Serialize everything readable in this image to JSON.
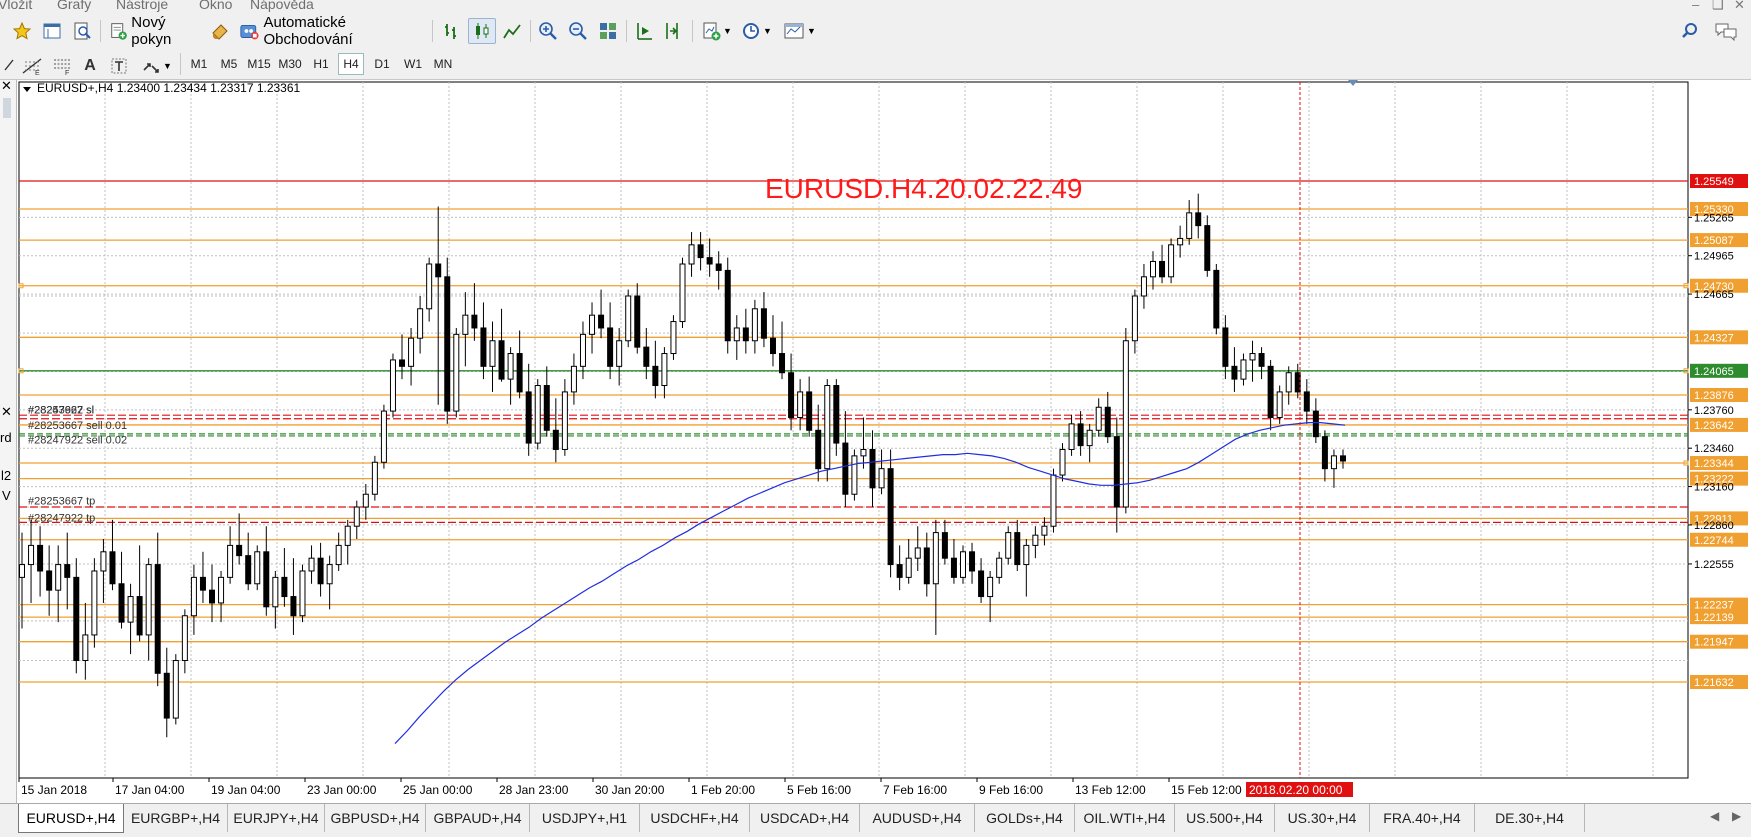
{
  "menu": [
    "Vložit",
    "Grafy",
    "Nástroje",
    "Okno",
    "Nápověda"
  ],
  "toolbar": {
    "new_order_label": "Nový pokyn",
    "auto_trading_label": "Automatické Obchodování",
    "timeframes": [
      "M1",
      "M5",
      "M15",
      "M30",
      "H1",
      "H4",
      "D1",
      "W1",
      "MN"
    ],
    "active_timeframe": "H4",
    "icons": [
      "favorites-icon",
      "data-window-icon",
      "navigator-icon",
      "new-order-icon",
      "metaeditor-icon",
      "auto-trading-icon",
      "bar-chart-icon",
      "candlestick-icon",
      "line-chart-icon",
      "zoom-in-icon",
      "zoom-out-icon",
      "tile-windows-icon",
      "chart-shift-icon",
      "auto-scroll-icon",
      "indicators-icon",
      "periodicity-icon",
      "templates-icon",
      "search-icon",
      "chat-icon",
      "cursor-icon",
      "fibonacci-icon",
      "channel-icon",
      "text-icon",
      "text-label-icon",
      "arrows-icon"
    ]
  },
  "chart": {
    "header_label": "EURUSD+,H4",
    "ohlc": "1.23400 1.23434 1.23317 1.23361",
    "watermark": "EURUSD.H4.20.02.22.49",
    "colors": {
      "background": "#ffffff",
      "grid": "#c0c0c0",
      "candle": "#000000",
      "ma": "#1f2ee0",
      "level": "#f0a030",
      "support": "#2e8b2e",
      "alert": "#e01010",
      "text": "#ff1a1a"
    },
    "price_labels": [
      {
        "price": 1.25549,
        "text": "1.25549",
        "kind": "alert"
      },
      {
        "price": 1.2533,
        "text": "1.25330",
        "kind": "level"
      },
      {
        "price": 1.25265,
        "text": "1.25265",
        "kind": "tick"
      },
      {
        "price": 1.25087,
        "text": "1.25087",
        "kind": "level"
      },
      {
        "price": 1.24965,
        "text": "1.24965",
        "kind": "tick"
      },
      {
        "price": 1.2473,
        "text": "1.24730",
        "kind": "level"
      },
      {
        "price": 1.24665,
        "text": "1.24665",
        "kind": "tick"
      },
      {
        "price": 1.24327,
        "text": "1.24327",
        "kind": "level"
      },
      {
        "price": 1.24065,
        "text": "1.24065",
        "kind": "support"
      },
      {
        "price": 1.23876,
        "text": "1.23876",
        "kind": "level"
      },
      {
        "price": 1.2376,
        "text": "1.23760",
        "kind": "tick"
      },
      {
        "price": 1.23642,
        "text": "1.23642",
        "kind": "level"
      },
      {
        "price": 1.2346,
        "text": "1.23460",
        "kind": "tick"
      },
      {
        "price": 1.23344,
        "text": "1.23344",
        "kind": "level"
      },
      {
        "price": 1.23222,
        "text": "1.23222",
        "kind": "level"
      },
      {
        "price": 1.2316,
        "text": "1.23160",
        "kind": "tick"
      },
      {
        "price": 1.22911,
        "text": "1.22911",
        "kind": "level"
      },
      {
        "price": 1.2286,
        "text": "1.22860",
        "kind": "tick"
      },
      {
        "price": 1.22744,
        "text": "1.22744",
        "kind": "level"
      },
      {
        "price": 1.22555,
        "text": "1.22555",
        "kind": "tick"
      },
      {
        "price": 1.22237,
        "text": "1.22237",
        "kind": "level"
      },
      {
        "price": 1.22139,
        "text": "1.22139",
        "kind": "level"
      },
      {
        "price": 1.21947,
        "text": "1.21947",
        "kind": "level"
      },
      {
        "price": 1.21632,
        "text": "1.21632",
        "kind": "level"
      }
    ],
    "extra_levels": [
      1.23718,
      1.2369,
      1.23572,
      1.23556,
      1.23,
      1.2288
    ],
    "order_labels": [
      {
        "price": 1.2373,
        "text": "#28253667 sl",
        "color": "#333333"
      },
      {
        "price": 1.2373,
        "text": "#28247922 sl",
        "color": "#333333"
      },
      {
        "price": 1.23586,
        "text": "#28253667 sell 0.01",
        "color": "#333333"
      },
      {
        "price": 1.23552,
        "text": "#28247922 sell 0.02",
        "color": "#333333"
      },
      {
        "price": 1.22988,
        "text": "#28253667 tp",
        "color": "#333333"
      },
      {
        "price": 1.22885,
        "text": "#28247922 tp",
        "color": "#333333"
      }
    ],
    "x_axis_labels": [
      "15 Jan 2018",
      "17 Jan 04:00",
      "19 Jan 04:00",
      "23 Jan 00:00",
      "25 Jan 00:00",
      "28 Jan 23:00",
      "30 Jan 20:00",
      "1 Feb 20:00",
      "5 Feb 16:00",
      "7 Feb 16:00",
      "9 Feb 16:00",
      "13 Feb 12:00",
      "15 Feb 12:00"
    ],
    "cursor_label": "2018.02.20 00:00",
    "left_strip_text": [
      "rd",
      "l2",
      "V"
    ]
  },
  "tabs": [
    {
      "label": "EURUSD+,H4",
      "active": true
    },
    {
      "label": "EURGBP+,H4",
      "active": false
    },
    {
      "label": "EURJPY+,H4",
      "active": false
    },
    {
      "label": "GBPUSD+,H4",
      "active": false
    },
    {
      "label": "GBPAUD+,H4",
      "active": false
    },
    {
      "label": "USDJPY+,H1",
      "active": false
    },
    {
      "label": "USDCHF+,H4",
      "active": false
    },
    {
      "label": "USDCAD+,H4",
      "active": false
    },
    {
      "label": "AUDUSD+,H4",
      "active": false
    },
    {
      "label": "GOLDs+,H4",
      "active": false
    },
    {
      "label": "OIL.WTI+,H4",
      "active": false
    },
    {
      "label": "US.500+,H4",
      "active": false
    },
    {
      "label": "US.30+,H4",
      "active": false
    },
    {
      "label": "FRA.40+,H4",
      "active": false
    },
    {
      "label": "DE.30+,H4",
      "active": false
    }
  ],
  "chart_data": {
    "type": "candlestick",
    "symbol": "EURUSD+",
    "timeframe": "H4",
    "ylim": [
      1.2155,
      1.2565
    ],
    "grid": true,
    "candles": [
      [
        1.2245,
        1.228,
        1.2205,
        1.2255
      ],
      [
        1.2255,
        1.229,
        1.2225,
        1.227
      ],
      [
        1.227,
        1.2285,
        1.223,
        1.225
      ],
      [
        1.225,
        1.227,
        1.2215,
        1.2235
      ],
      [
        1.2235,
        1.227,
        1.221,
        1.2255
      ],
      [
        1.2255,
        1.228,
        1.222,
        1.2245
      ],
      [
        1.2245,
        1.226,
        1.217,
        1.218
      ],
      [
        1.218,
        1.2225,
        1.2165,
        1.22
      ],
      [
        1.22,
        1.226,
        1.219,
        1.225
      ],
      [
        1.225,
        1.2275,
        1.2225,
        1.2265
      ],
      [
        1.2265,
        1.229,
        1.2235,
        1.224
      ],
      [
        1.224,
        1.2265,
        1.2205,
        1.221
      ],
      [
        1.221,
        1.224,
        1.2185,
        1.223
      ],
      [
        1.223,
        1.227,
        1.2195,
        1.22
      ],
      [
        1.22,
        1.226,
        1.218,
        1.2255
      ],
      [
        1.2255,
        1.228,
        1.216,
        1.217
      ],
      [
        1.217,
        1.219,
        1.212,
        1.2135
      ],
      [
        1.2135,
        1.2185,
        1.213,
        1.218
      ],
      [
        1.218,
        1.222,
        1.217,
        1.2215
      ],
      [
        1.2215,
        1.2255,
        1.22,
        1.2245
      ],
      [
        1.2245,
        1.2265,
        1.2225,
        1.2235
      ],
      [
        1.2235,
        1.2255,
        1.221,
        1.2225
      ],
      [
        1.2225,
        1.225,
        1.221,
        1.2245
      ],
      [
        1.2245,
        1.2285,
        1.224,
        1.227
      ],
      [
        1.227,
        1.2295,
        1.2255,
        1.2262
      ],
      [
        1.2262,
        1.228,
        1.2235,
        1.224
      ],
      [
        1.224,
        1.227,
        1.2235,
        1.2265
      ],
      [
        1.2265,
        1.2285,
        1.2215,
        1.2222
      ],
      [
        1.2222,
        1.225,
        1.2205,
        1.2245
      ],
      [
        1.2245,
        1.2268,
        1.2222,
        1.223
      ],
      [
        1.223,
        1.226,
        1.22,
        1.2215
      ],
      [
        1.2215,
        1.2255,
        1.221,
        1.225
      ],
      [
        1.225,
        1.227,
        1.224,
        1.226
      ],
      [
        1.226,
        1.2272,
        1.223,
        1.224
      ],
      [
        1.224,
        1.2262,
        1.222,
        1.2255
      ],
      [
        1.2255,
        1.228,
        1.225,
        1.227
      ],
      [
        1.227,
        1.229,
        1.2255,
        1.2285
      ],
      [
        1.2285,
        1.2305,
        1.2275,
        1.23
      ],
      [
        1.23,
        1.2318,
        1.229,
        1.231
      ],
      [
        1.231,
        1.234,
        1.2305,
        1.2335
      ],
      [
        1.2335,
        1.238,
        1.233,
        1.2375
      ],
      [
        1.2375,
        1.242,
        1.237,
        1.2415
      ],
      [
        1.2415,
        1.2435,
        1.24,
        1.241
      ],
      [
        1.241,
        1.244,
        1.2395,
        1.2432
      ],
      [
        1.2432,
        1.2465,
        1.242,
        1.2455
      ],
      [
        1.2455,
        1.2495,
        1.2445,
        1.249
      ],
      [
        1.249,
        1.2535,
        1.238,
        1.248
      ],
      [
        1.248,
        1.2495,
        1.2365,
        1.2375
      ],
      [
        1.2375,
        1.244,
        1.237,
        1.2435
      ],
      [
        1.2435,
        1.2468,
        1.241,
        1.245
      ],
      [
        1.245,
        1.2475,
        1.243,
        1.244
      ],
      [
        1.244,
        1.246,
        1.24,
        1.241
      ],
      [
        1.241,
        1.2445,
        1.239,
        1.243
      ],
      [
        1.243,
        1.2455,
        1.2398,
        1.24
      ],
      [
        1.24,
        1.2425,
        1.238,
        1.242
      ],
      [
        1.242,
        1.2438,
        1.2385,
        1.239
      ],
      [
        1.239,
        1.2412,
        1.234,
        1.235
      ],
      [
        1.235,
        1.24,
        1.2345,
        1.2395
      ],
      [
        1.2395,
        1.241,
        1.2355,
        1.236
      ],
      [
        1.236,
        1.2385,
        1.2335,
        1.2345
      ],
      [
        1.2345,
        1.24,
        1.234,
        1.239
      ],
      [
        1.239,
        1.242,
        1.238,
        1.241
      ],
      [
        1.241,
        1.2445,
        1.24,
        1.2435
      ],
      [
        1.2435,
        1.246,
        1.242,
        1.245
      ],
      [
        1.245,
        1.247,
        1.2432,
        1.244
      ],
      [
        1.244,
        1.246,
        1.24,
        1.241
      ],
      [
        1.241,
        1.244,
        1.2395,
        1.243
      ],
      [
        1.243,
        1.247,
        1.2425,
        1.2465
      ],
      [
        1.2465,
        1.2475,
        1.242,
        1.2425
      ],
      [
        1.2425,
        1.244,
        1.24,
        1.241
      ],
      [
        1.241,
        1.243,
        1.2385,
        1.2395
      ],
      [
        1.2395,
        1.2425,
        1.2385,
        1.242
      ],
      [
        1.242,
        1.245,
        1.2415,
        1.2445
      ],
      [
        1.2445,
        1.2495,
        1.244,
        1.249
      ],
      [
        1.249,
        1.2515,
        1.248,
        1.2505
      ],
      [
        1.2505,
        1.2515,
        1.2485,
        1.2495
      ],
      [
        1.2495,
        1.251,
        1.248,
        1.249
      ],
      [
        1.249,
        1.25,
        1.247,
        1.2485
      ],
      [
        1.2485,
        1.2495,
        1.242,
        1.243
      ],
      [
        1.243,
        1.245,
        1.2415,
        1.244
      ],
      [
        1.244,
        1.2455,
        1.242,
        1.243
      ],
      [
        1.243,
        1.2462,
        1.242,
        1.2455
      ],
      [
        1.2455,
        1.2468,
        1.2425,
        1.2432
      ],
      [
        1.2432,
        1.245,
        1.241,
        1.242
      ],
      [
        1.242,
        1.2445,
        1.24,
        1.2405
      ],
      [
        1.2405,
        1.242,
        1.236,
        1.237
      ],
      [
        1.237,
        1.24,
        1.236,
        1.239
      ],
      [
        1.239,
        1.2402,
        1.2355,
        1.236
      ],
      [
        1.236,
        1.238,
        1.232,
        1.233
      ],
      [
        1.233,
        1.24,
        1.232,
        1.2395
      ],
      [
        1.2395,
        1.24,
        1.234,
        1.235
      ],
      [
        1.235,
        1.2375,
        1.23,
        1.231
      ],
      [
        1.231,
        1.2345,
        1.2305,
        1.234
      ],
      [
        1.234,
        1.237,
        1.233,
        1.2345
      ],
      [
        1.2345,
        1.236,
        1.23,
        1.2315
      ],
      [
        1.2315,
        1.2345,
        1.231,
        1.233
      ],
      [
        1.233,
        1.2345,
        1.2245,
        1.2255
      ],
      [
        1.2255,
        1.227,
        1.2235,
        1.2245
      ],
      [
        1.2245,
        1.2275,
        1.224,
        1.226
      ],
      [
        1.226,
        1.2285,
        1.225,
        1.2268
      ],
      [
        1.2268,
        1.228,
        1.223,
        1.224
      ],
      [
        1.224,
        1.229,
        1.22,
        1.228
      ],
      [
        1.228,
        1.229,
        1.2255,
        1.226
      ],
      [
        1.226,
        1.2275,
        1.224,
        1.2245
      ],
      [
        1.2245,
        1.227,
        1.224,
        1.2265
      ],
      [
        1.2265,
        1.2272,
        1.224,
        1.225
      ],
      [
        1.225,
        1.226,
        1.2225,
        1.223
      ],
      [
        1.223,
        1.225,
        1.221,
        1.2245
      ],
      [
        1.2245,
        1.2265,
        1.224,
        1.226
      ],
      [
        1.226,
        1.2285,
        1.2255,
        1.228
      ],
      [
        1.228,
        1.229,
        1.225,
        1.2255
      ],
      [
        1.2255,
        1.2275,
        1.223,
        1.227
      ],
      [
        1.227,
        1.2285,
        1.226,
        1.2278
      ],
      [
        1.2278,
        1.2292,
        1.227,
        1.2285
      ],
      [
        1.2285,
        1.233,
        1.228,
        1.2325
      ],
      [
        1.2325,
        1.235,
        1.232,
        1.2345
      ],
      [
        1.2345,
        1.2372,
        1.234,
        1.2365
      ],
      [
        1.2365,
        1.2375,
        1.234,
        1.2348
      ],
      [
        1.2348,
        1.2365,
        1.2335,
        1.236
      ],
      [
        1.236,
        1.2385,
        1.2355,
        1.2378
      ],
      [
        1.2378,
        1.239,
        1.235,
        1.2355
      ],
      [
        1.2355,
        1.237,
        1.228,
        1.23
      ],
      [
        1.23,
        1.244,
        1.2295,
        1.243
      ],
      [
        1.243,
        1.247,
        1.242,
        1.2465
      ],
      [
        1.2465,
        1.249,
        1.2455,
        1.248
      ],
      [
        1.248,
        1.25,
        1.247,
        1.2492
      ],
      [
        1.2492,
        1.2505,
        1.2475,
        1.248
      ],
      [
        1.248,
        1.251,
        1.2475,
        1.2505
      ],
      [
        1.2505,
        1.252,
        1.2495,
        1.251
      ],
      [
        1.251,
        1.254,
        1.2505,
        1.253
      ],
      [
        1.253,
        1.2545,
        1.251,
        1.252
      ],
      [
        1.252,
        1.2528,
        1.248,
        1.2485
      ],
      [
        1.2485,
        1.249,
        1.2435,
        1.244
      ],
      [
        1.244,
        1.245,
        1.24,
        1.241
      ],
      [
        1.241,
        1.2425,
        1.239,
        1.24
      ],
      [
        1.24,
        1.242,
        1.2395,
        1.2415
      ],
      [
        1.2415,
        1.243,
        1.2398,
        1.242
      ],
      [
        1.242,
        1.2425,
        1.24,
        1.241
      ],
      [
        1.241,
        1.2415,
        1.236,
        1.237
      ],
      [
        1.237,
        1.2395,
        1.2365,
        1.239
      ],
      [
        1.239,
        1.241,
        1.238,
        1.2405
      ],
      [
        1.2405,
        1.2412,
        1.2385,
        1.239
      ],
      [
        1.239,
        1.24,
        1.2365,
        1.2375
      ],
      [
        1.2375,
        1.2385,
        1.235,
        1.2355
      ],
      [
        1.2355,
        1.236,
        1.232,
        1.233
      ],
      [
        1.233,
        1.2345,
        1.2315,
        1.234
      ],
      [
        1.234,
        1.2345,
        1.233,
        1.2336
      ]
    ],
    "ma_line": [
      1.2115,
      1.2125,
      1.2136,
      1.2146,
      1.2156,
      1.2165,
      1.2173,
      1.218,
      1.2187,
      1.2194,
      1.22,
      1.2206,
      1.2213,
      1.2219,
      1.2225,
      1.2231,
      1.2237,
      1.2242,
      1.2248,
      1.2254,
      1.2259,
      1.2265,
      1.227,
      1.2276,
      1.2281,
      1.2287,
      1.2292,
      1.2297,
      1.2302,
      1.2307,
      1.2311,
      1.2315,
      1.2319,
      1.2322,
      1.2325,
      1.2328,
      1.233,
      1.2332,
      1.2334,
      1.2335,
      1.2336,
      1.2337,
      1.2338,
      1.2339,
      1.234,
      1.2341,
      1.2341,
      1.2342,
      1.2341,
      1.234,
      1.2338,
      1.2335,
      1.2331,
      1.2328,
      1.2325,
      1.2322,
      1.232,
      1.2318,
      1.2317,
      1.2317,
      1.2318,
      1.2319,
      1.2321,
      1.2324,
      1.2327,
      1.233,
      1.2335,
      1.2341,
      1.2347,
      1.2353,
      1.2357,
      1.236,
      1.2362,
      1.2364,
      1.2365,
      1.2366,
      1.2366,
      1.2365,
      1.2364
    ]
  }
}
